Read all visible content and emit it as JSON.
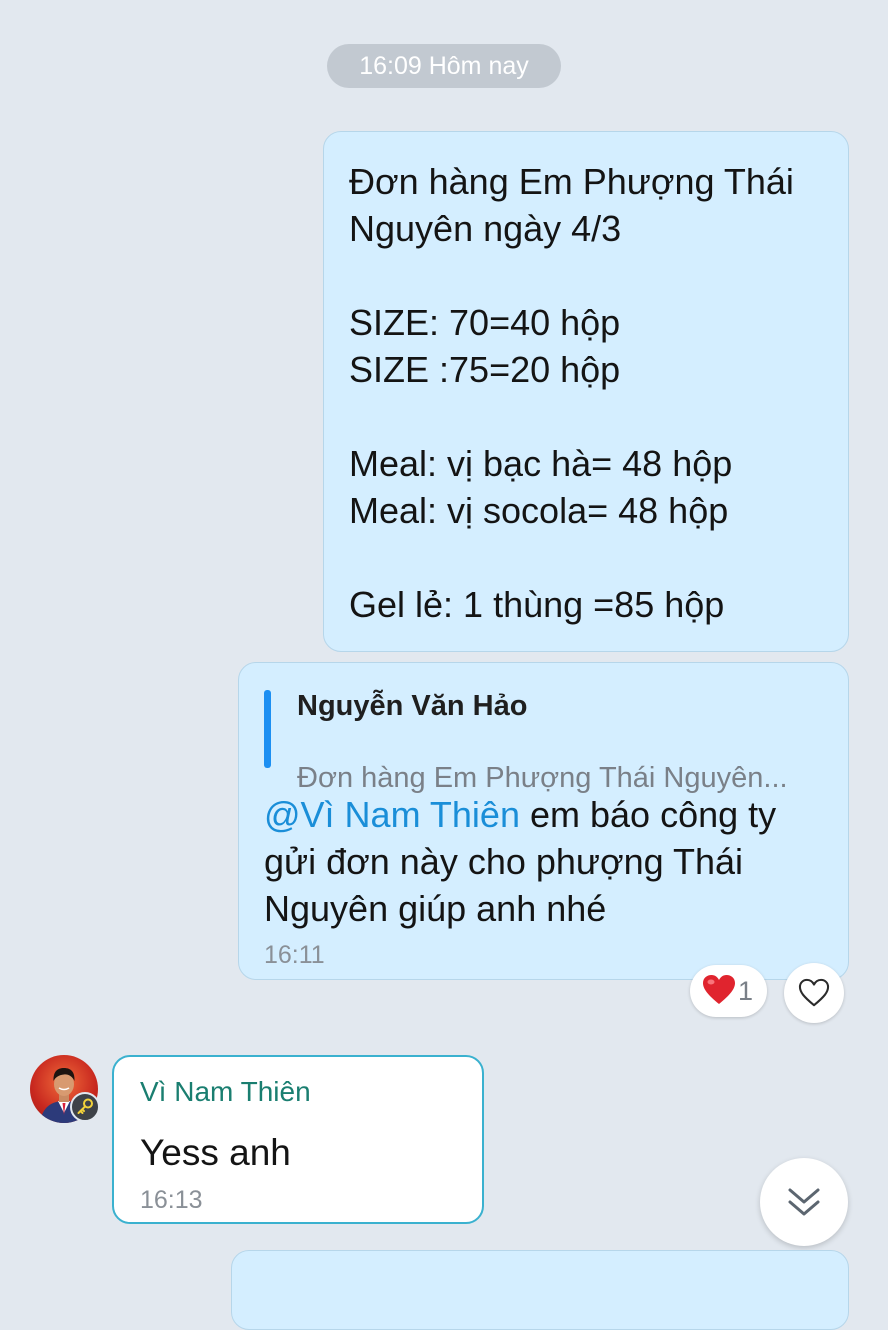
{
  "date_separator": "16:09 Hôm nay",
  "messages": {
    "order": {
      "lines": [
        "Đơn hàng Em Phượng Thái",
        "Nguyên ngày 4/3",
        "",
        "SIZE: 70=40 hộp",
        "SIZE :75=20 hộp",
        "",
        "Meal: vị bạc hà= 48 hộp",
        "Meal: vị socola= 48 hộp",
        "",
        "Gel lẻ: 1 thùng =85 hộp"
      ]
    },
    "reply": {
      "quote_author": "Nguyễn Văn Hảo",
      "quote_preview": "Đơn hàng Em Phượng Thái Nguyên...",
      "mention": "@Vì Nam Thiên",
      "text": " em báo công ty gửi đơn này cho phượng Thái Nguyên giúp anh nhé",
      "time": "16:11",
      "reaction": {
        "icon": "heart-icon",
        "count": "1",
        "color": "#e0242e"
      },
      "react_button_icon": "heart-outline-icon"
    },
    "incoming": {
      "sender": "Vì Nam Thiên",
      "text": "Yess anh",
      "time": "16:13",
      "avatar_badge_icon": "key-icon"
    }
  },
  "scroll_button_icon": "double-chevron-down-icon",
  "colors": {
    "background": "#e2e8ef",
    "outgoing_bubble": "#d4eeff",
    "incoming_border": "#3ab1cf",
    "mention": "#1a8ed8",
    "sender_name": "#1a7e70",
    "quote_bar": "#1c8ff2"
  }
}
